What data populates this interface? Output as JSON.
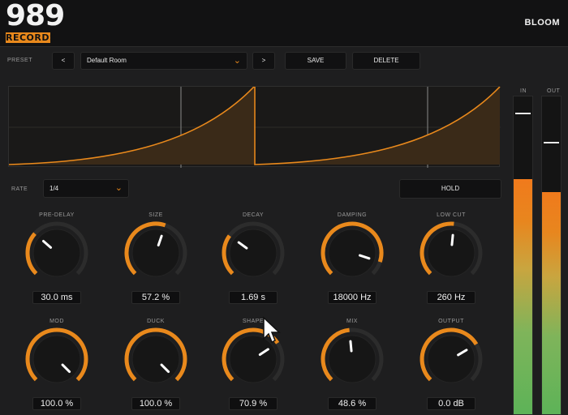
{
  "header": {
    "logo_number": "989",
    "logo_sub": "RECORDS",
    "plugin_name": "BLOOM"
  },
  "preset": {
    "label": "PRESET",
    "prev_label": "<",
    "next_label": ">",
    "current": "Default Room",
    "save_label": "SAVE",
    "delete_label": "DELETE"
  },
  "rate": {
    "label": "RATE",
    "value": "1/4"
  },
  "hold_label": "HOLD",
  "meters": {
    "in_label": "IN",
    "out_label": "OUT",
    "in_level": 0.74,
    "out_level": 0.7
  },
  "knobs_row1": [
    {
      "name": "PRE-DELAY",
      "value": "30.0 ms",
      "level": 0.32
    },
    {
      "name": "SIZE",
      "value": "57.2 %",
      "level": 0.57
    },
    {
      "name": "DECAY",
      "value": "1.69 s",
      "level": 0.3
    },
    {
      "name": "DAMPING",
      "value": "18000 Hz",
      "level": 0.9
    },
    {
      "name": "LOW CUT",
      "value": "260 Hz",
      "level": 0.52
    }
  ],
  "knobs_row2": [
    {
      "name": "MOD",
      "value": "100.0 %",
      "level": 1.0
    },
    {
      "name": "DUCK",
      "value": "100.0 %",
      "level": 1.0
    },
    {
      "name": "SHAPE",
      "value": "70.9 %",
      "level": 0.71
    },
    {
      "name": "MIX",
      "value": "48.6 %",
      "level": 0.48
    },
    {
      "name": "OUTPUT",
      "value": "0.0 dB",
      "level": 0.72
    }
  ],
  "colors": {
    "accent": "#e9891c",
    "track": "#2c2c2c",
    "knob": "#161616"
  }
}
